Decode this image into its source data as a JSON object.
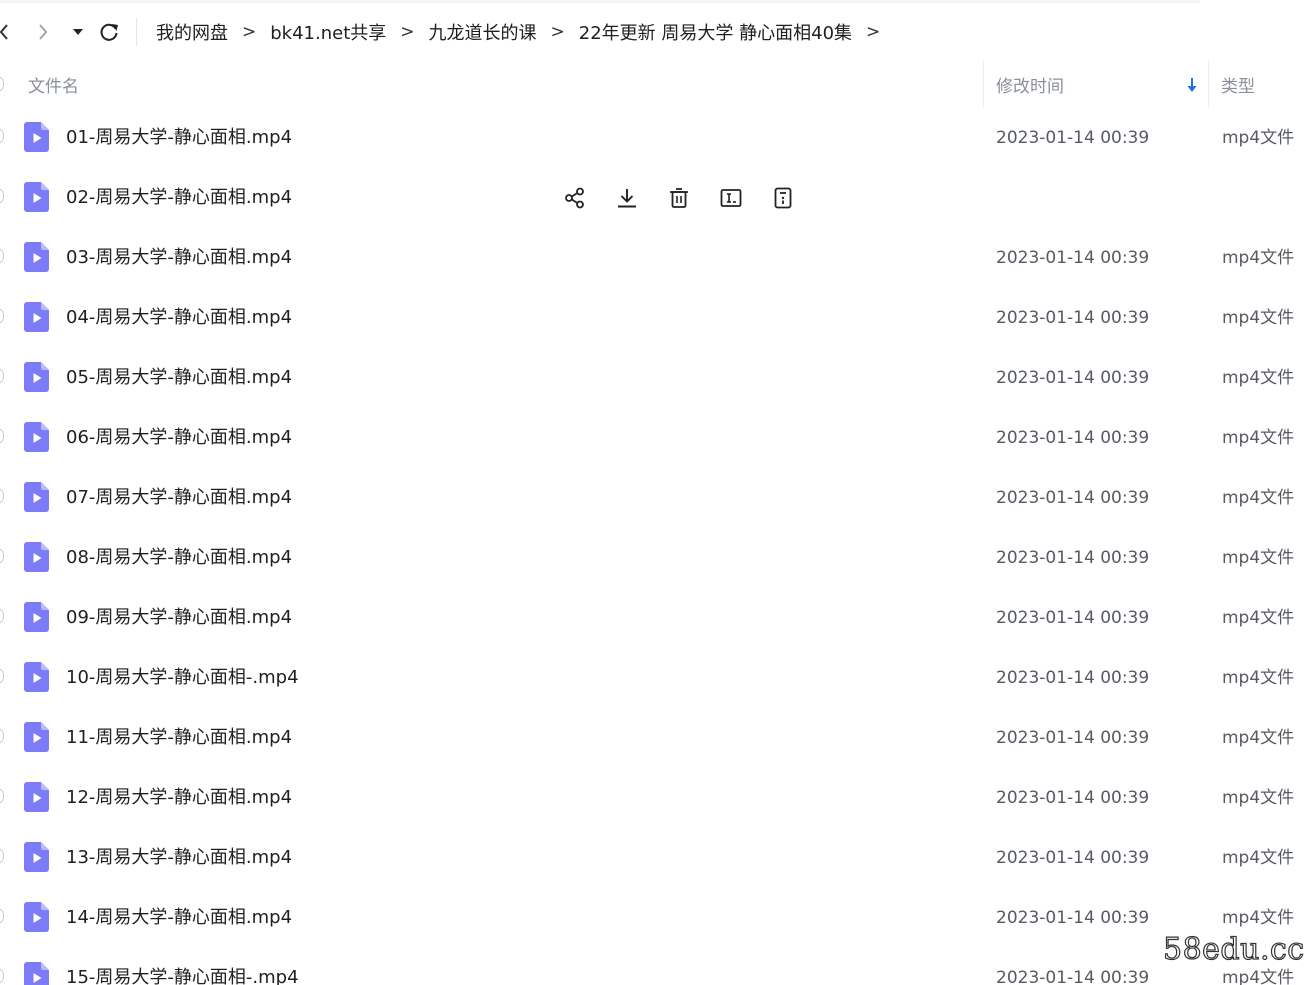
{
  "breadcrumb": [
    {
      "label": "我的网盘"
    },
    {
      "label": "bk41.net共享"
    },
    {
      "label": "九龙道长的课"
    },
    {
      "label": "22年更新 周易大学 静心面相40集"
    }
  ],
  "breadcrumb_separator": ">",
  "columns": {
    "name": "文件名",
    "modified": "修改时间",
    "type": "类型"
  },
  "sort": {
    "column": "修改时间",
    "direction": "descending"
  },
  "files": [
    {
      "name": "01-周易大学-静心面相.mp4",
      "time": "2023-01-14 00:39",
      "type": "mp4文件"
    },
    {
      "name": "02-周易大学-静心面相.mp4",
      "time": "",
      "type": "",
      "hovered": true
    },
    {
      "name": "03-周易大学-静心面相.mp4",
      "time": "2023-01-14 00:39",
      "type": "mp4文件"
    },
    {
      "name": "04-周易大学-静心面相.mp4",
      "time": "2023-01-14 00:39",
      "type": "mp4文件"
    },
    {
      "name": "05-周易大学-静心面相.mp4",
      "time": "2023-01-14 00:39",
      "type": "mp4文件"
    },
    {
      "name": "06-周易大学-静心面相.mp4",
      "time": "2023-01-14 00:39",
      "type": "mp4文件"
    },
    {
      "name": "07-周易大学-静心面相.mp4",
      "time": "2023-01-14 00:39",
      "type": "mp4文件"
    },
    {
      "name": "08-周易大学-静心面相.mp4",
      "time": "2023-01-14 00:39",
      "type": "mp4文件"
    },
    {
      "name": "09-周易大学-静心面相.mp4",
      "time": "2023-01-14 00:39",
      "type": "mp4文件"
    },
    {
      "name": "10-周易大学-静心面相-.mp4",
      "time": "2023-01-14 00:39",
      "type": "mp4文件"
    },
    {
      "name": "11-周易大学-静心面相.mp4",
      "time": "2023-01-14 00:39",
      "type": "mp4文件"
    },
    {
      "name": "12-周易大学-静心面相.mp4",
      "time": "2023-01-14 00:39",
      "type": "mp4文件"
    },
    {
      "name": "13-周易大学-静心面相.mp4",
      "time": "2023-01-14 00:39",
      "type": "mp4文件"
    },
    {
      "name": "14-周易大学-静心面相.mp4",
      "time": "2023-01-14 00:39",
      "type": "mp4文件"
    },
    {
      "name": "15-周易大学-静心面相-.mp4",
      "time": "2023-01-14 00:39",
      "type": "mp4文件"
    }
  ],
  "row_actions": [
    "share-icon",
    "download-icon",
    "delete-icon",
    "rename-icon",
    "more-info-icon"
  ],
  "icons": {
    "back": "chevron-left-icon",
    "forward": "chevron-right-icon",
    "history": "caret-down-icon",
    "refresh": "refresh-icon",
    "file": "video-file-icon",
    "sort": "arrow-down-icon"
  },
  "colors": {
    "file_icon": "#7c7cf8",
    "sort_arrow": "#1a73e8",
    "header_text": "#8a8f99"
  },
  "watermark": "58edu.cc"
}
